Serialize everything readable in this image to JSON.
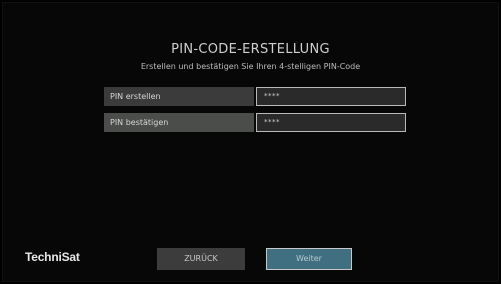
{
  "header": {
    "title": "PIN-CODE-ERSTELLUNG",
    "subtitle": "Erstellen und bestätigen Sie Ihren 4-stelligen PIN-Code"
  },
  "form": {
    "fields": [
      {
        "label": "PIN erstellen",
        "value": "****"
      },
      {
        "label": "PIN bestätigen",
        "value": "****"
      }
    ]
  },
  "footer": {
    "brand": "TechniSat",
    "back_label": "ZURÜCK",
    "next_label": "Weiter"
  },
  "colors": {
    "background": "#070707",
    "label_bg": "#3b3b3b",
    "focused_label_bg": "#4a4d4a",
    "input_bg": "#2a2a2a",
    "accent_button": "#3f6f80"
  }
}
